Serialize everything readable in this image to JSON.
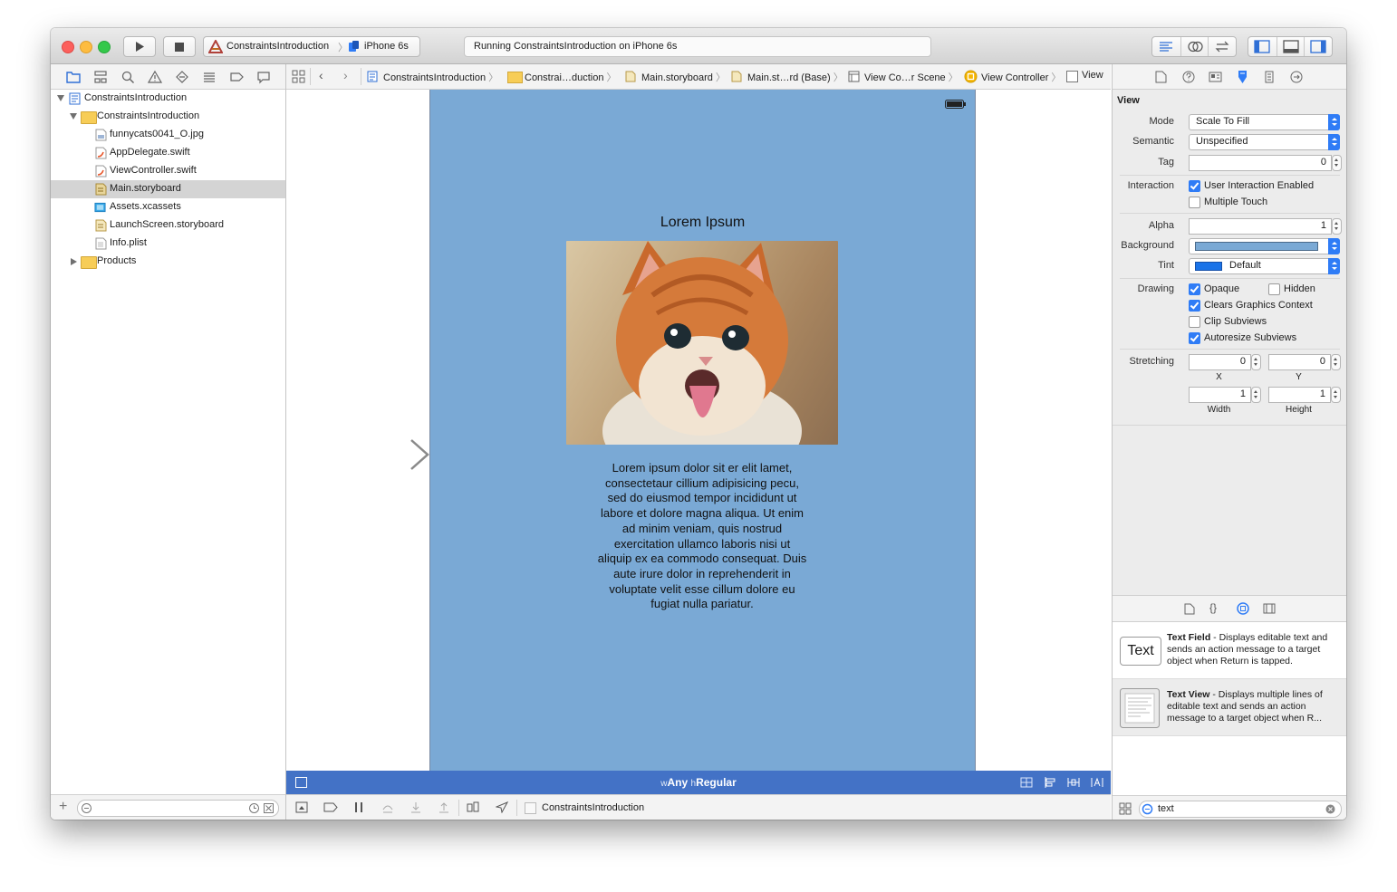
{
  "toolbar": {
    "scheme_name": "ConstraintsIntroduction",
    "device_name": "iPhone 6s",
    "activity_status": "Running ConstraintsIntroduction on iPhone 6s",
    "run_icon": "play-icon",
    "stop_icon": "stop-icon"
  },
  "navigator": {
    "tabs": [
      "folder-icon",
      "hierarchy-icon",
      "search-icon",
      "warning-icon",
      "test-icon",
      "debug-icon",
      "breakpoint-icon",
      "report-icon"
    ],
    "tree": [
      {
        "label": "ConstraintsIntroduction",
        "kind": "project",
        "level": 0,
        "disclosure": "open"
      },
      {
        "label": "ConstraintsIntroduction",
        "kind": "folder",
        "level": 1,
        "disclosure": "open"
      },
      {
        "label": "funnycats0041_O.jpg",
        "kind": "image",
        "level": 2
      },
      {
        "label": "AppDelegate.swift",
        "kind": "swift",
        "level": 2
      },
      {
        "label": "ViewController.swift",
        "kind": "swift",
        "level": 2
      },
      {
        "label": "Main.storyboard",
        "kind": "storyboard",
        "level": 2,
        "selected": true
      },
      {
        "label": "Assets.xcassets",
        "kind": "assets",
        "level": 2
      },
      {
        "label": "LaunchScreen.storyboard",
        "kind": "storyboard",
        "level": 2
      },
      {
        "label": "Info.plist",
        "kind": "plist",
        "level": 2
      },
      {
        "label": "Products",
        "kind": "folder",
        "level": 1,
        "disclosure": "closed"
      }
    ]
  },
  "jumpbar": {
    "crumbs": [
      "ConstraintsIntroduction",
      "Constrai…duction",
      "Main.storyboard",
      "Main.st…rd (Base)",
      "View Co…r Scene",
      "View Controller",
      "View"
    ]
  },
  "scene": {
    "title_label": "Lorem Ipsum",
    "body_text": "Lorem ipsum dolor sit er elit lamet, consectetaur cillium adipisicing pecu, sed do eiusmod tempor incididunt ut labore et dolore magna aliqua. Ut enim ad minim veniam, quis nostrud exercitation ullamco laboris nisi ut aliquip ex ea commodo consequat. Duis aute irure dolor in reprehenderit in voluptate velit esse cillum dolore eu fugiat nulla pariatur.",
    "background_color": "#7aa9d5"
  },
  "sizeclass": {
    "w_prefix": "w",
    "w_value": "Any",
    "h_prefix": "h",
    "h_value": "Regular"
  },
  "bottombar": {
    "label": "ConstraintsIntroduction"
  },
  "inspector": {
    "section_title": "View",
    "mode_label": "Mode",
    "mode_value": "Scale To Fill",
    "semantic_label": "Semantic",
    "semantic_value": "Unspecified",
    "tag_label": "Tag",
    "tag_value": "0",
    "interaction_label": "Interaction",
    "user_interaction_label": "User Interaction Enabled",
    "user_interaction_checked": true,
    "multiple_touch_label": "Multiple Touch",
    "multiple_touch_checked": false,
    "alpha_label": "Alpha",
    "alpha_value": "1",
    "background_label": "Background",
    "background_color": "#7aa9d5",
    "tint_label": "Tint",
    "tint_value": "Default",
    "tint_color": "#1a73e8",
    "drawing_label": "Drawing",
    "opaque_label": "Opaque",
    "opaque_checked": true,
    "hidden_label": "Hidden",
    "hidden_checked": false,
    "clears_label": "Clears Graphics Context",
    "clears_checked": true,
    "clip_label": "Clip Subviews",
    "clip_checked": false,
    "autoresize_label": "Autoresize Subviews",
    "autoresize_checked": true,
    "stretching_label": "Stretching",
    "stretch_x": "0",
    "stretch_y": "0",
    "stretch_w": "1",
    "stretch_h": "1",
    "x_label": "X",
    "y_label": "Y",
    "width_label": "Width",
    "height_label": "Height"
  },
  "library": {
    "items": [
      {
        "icon_text": "Text",
        "title": "Text Field",
        "desc": " - Displays editable text and sends an action message to a target object when Return is tapped."
      },
      {
        "title": "Text View",
        "desc": " - Displays multiple lines of editable text and sends an action message to a target object when R..."
      }
    ],
    "filter_value": "text"
  }
}
